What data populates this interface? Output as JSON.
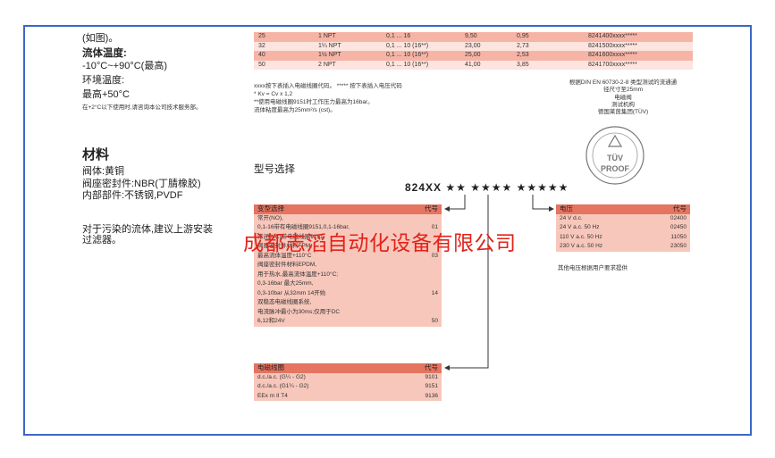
{
  "left_top": {
    "lines": [
      "(如图)。"
    ],
    "fluid_temp_title": "流体温度:",
    "fluid_temp_value": "-10°C~+90°C(最高)",
    "ambient_title": "环境温度:",
    "ambient_value": "最高+50°C",
    "ambient_note": "在+2°C以下使用时,请咨询本公司技术服务部。"
  },
  "flow_table": {
    "rows": [
      [
        "25",
        "1 NPT",
        "0,1 ... 16",
        "9,50",
        "0,95",
        "8241400xxxx*****"
      ],
      [
        "32",
        "1¼ NPT",
        "0,1 ... 10 (16**)",
        "23,00",
        "2,73",
        "8241500xxxx*****"
      ],
      [
        "40",
        "1½ NPT",
        "0,1 ... 10 (16**)",
        "25,00",
        "2,53",
        "8241600xxxx*****"
      ],
      [
        "50",
        "2 NPT",
        "0,1 ... 10 (16**)",
        "41,00",
        "3,85",
        "8241700xxxx*****"
      ]
    ]
  },
  "notes": {
    "line1": "xxxx按下表插入电磁线圈代码。 ***** 按下表插入电压代码",
    "line2": "* Kv = Cv x 1,2",
    "line3": "**使用电磁线圈9151时工作压力最高为16bar。",
    "line4": "流体粘度最高为25mm²/s (cst)。"
  },
  "certification": {
    "line1": "根据DIN EN 60730-2-8 类型测试的流通通",
    "line2": "径尺寸至25mm",
    "line3": "电磁阀",
    "line4": "测试机构",
    "line5": "德国莱茵集团(TÜV)",
    "logo_text": "TÜV PROOF"
  },
  "materials": {
    "title": "材料",
    "lines": [
      "阀体:黄铜",
      "阀座密封件:NBR(丁腈橡胶)",
      "内部部件:不锈钢,PVDF"
    ],
    "filter_note_1": "对于污染的流体,建议上游安装",
    "filter_note_2": "过滤器。"
  },
  "model_selection": {
    "title": "型号选择",
    "code": "824XX ★★ ★★★★ ★★★★★"
  },
  "variant_table": {
    "header_label": "变型选择",
    "header_code": "代号",
    "rows": [
      {
        "label": "常开(NO),",
        "code": ""
      },
      {
        "label": "0,1-16带有电磁线圈9151,0,1-16bar,",
        "code": "01"
      },
      {
        "label": "常闭(NC)带电磁线圈9151,",
        "code": ""
      },
      {
        "label": "阀座密封件材料FPM,",
        "code": ""
      },
      {
        "label": "最高流体温度+110°C",
        "code": "03"
      },
      {
        "label": "阀座密封件材料EPDM,",
        "code": ""
      },
      {
        "label": "用于热水,最高流体温度+110°C;",
        "code": ""
      },
      {
        "label": "0,3-16bar 最大25mm,",
        "code": ""
      },
      {
        "label": "0,3-10bar 从32mm 14开始",
        "code": "14"
      },
      {
        "label": "双稳态电磁线圈系统,",
        "code": ""
      },
      {
        "label": "电流脉冲最小为30ms;仅用于DC",
        "code": ""
      },
      {
        "label": "6,12和24V",
        "code": "50"
      }
    ]
  },
  "coil_table": {
    "header_label": "电磁线圈",
    "header_code": "代号",
    "rows": [
      {
        "label": "d.c./a.c. (G¼ - G2)",
        "code": "9101"
      },
      {
        "label": "d.c./a.c. (G1¼ - G2)",
        "code": "9151"
      },
      {
        "label": "EEx m II T4",
        "code": "9136"
      }
    ]
  },
  "voltage_table": {
    "header_label": "电压",
    "header_code": "代号",
    "rows": [
      {
        "label": "24 V d.c.",
        "code": "02400"
      },
      {
        "label": "24 V a.c. 50 Hz",
        "code": "02450"
      },
      {
        "label": "110 V a.c. 50 Hz",
        "code": "11050"
      },
      {
        "label": "230 V a.c. 50 Hz",
        "code": "23050"
      }
    ],
    "footnote": "其他电压根据用户要求提供"
  },
  "watermark": "成都志滔自动化设备有限公司",
  "colors": {
    "frame": "#3a67c8",
    "header": "#e57460",
    "row_dark": "#f6b4a6",
    "row_light": "#fde4de",
    "watermark": "#e2231a"
  }
}
